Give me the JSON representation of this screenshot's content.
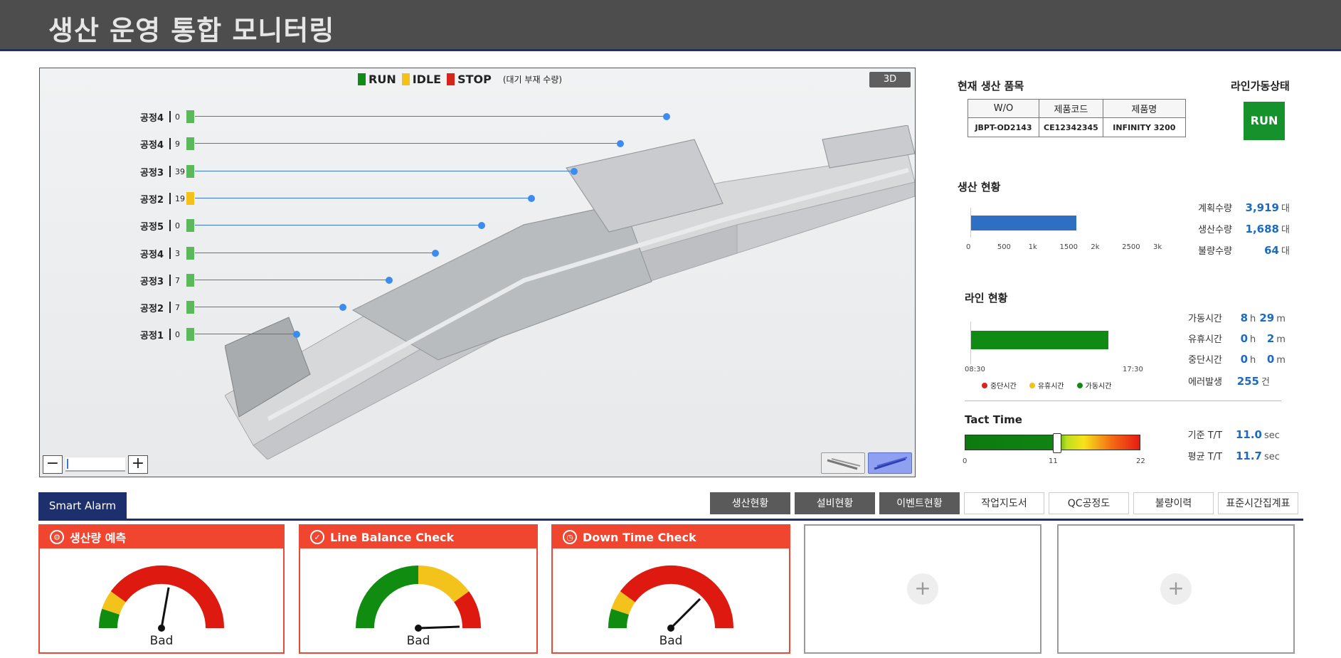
{
  "header": {
    "title": "생산 운영 통합 모니터링"
  },
  "viewer": {
    "legend": [
      {
        "label": "RUN",
        "color": "#128a18"
      },
      {
        "label": "IDLE",
        "color": "#f4c11a"
      },
      {
        "label": "STOP",
        "color": "#d8251b"
      }
    ],
    "legend_note": "(대기 부재 수량)",
    "btn_3d": "3D",
    "processes": [
      {
        "name": "공정4",
        "count": "0",
        "status": "run"
      },
      {
        "name": "공정4",
        "count": "9",
        "status": "run"
      },
      {
        "name": "공정3",
        "count": "39",
        "status": "run"
      },
      {
        "name": "공정2",
        "count": "19",
        "status": "idle"
      },
      {
        "name": "공정5",
        "count": "0",
        "status": "run"
      },
      {
        "name": "공정4",
        "count": "3",
        "status": "run"
      },
      {
        "name": "공정3",
        "count": "7",
        "status": "run"
      },
      {
        "name": "공정2",
        "count": "7",
        "status": "run"
      },
      {
        "name": "공정1",
        "count": "0",
        "status": "run"
      }
    ],
    "zoom_minus": "−",
    "zoom_plus": "+"
  },
  "product": {
    "title": "현재 생산 품목",
    "headers": [
      "W/O",
      "제품코드",
      "제품명"
    ],
    "row": [
      "JBPT-OD2143",
      "CE12342345",
      "INFINITY 3200"
    ]
  },
  "line_status": {
    "title": "라인가동상태",
    "value": "RUN"
  },
  "production": {
    "title": "생산 현황",
    "bar_value": 1688,
    "axis_max": 3000,
    "ticks": [
      "0",
      "500",
      "1k",
      "1500",
      "2k",
      "2500",
      "3k"
    ],
    "items": [
      {
        "label": "계획수량",
        "value": "3,919",
        "unit": "대"
      },
      {
        "label": "생산수량",
        "value": "1,688",
        "unit": "대"
      },
      {
        "label": "불량수량",
        "value": "64",
        "unit": "대"
      }
    ]
  },
  "line": {
    "title": "라인 현황",
    "run_fraction": 0.7,
    "start": "08:30",
    "end": "17:30",
    "legend": [
      {
        "label": "중단시간",
        "color": "#d8251b"
      },
      {
        "label": "유휴시간",
        "color": "#f4c11a"
      },
      {
        "label": "가동시간",
        "color": "#128a18"
      }
    ],
    "items": [
      {
        "label": "가동시간",
        "h": "8",
        "m": "29"
      },
      {
        "label": "유휴시간",
        "h": "0",
        "m": "2"
      },
      {
        "label": "중단시간",
        "h": "0",
        "m": "0"
      }
    ],
    "error_label": "에러발생",
    "error_value": "255",
    "error_unit": "건",
    "h_unit": "h",
    "m_unit": "m"
  },
  "tact": {
    "title": "Tact Time",
    "min": "0",
    "mid": "11",
    "max": "22",
    "items": [
      {
        "label": "기준 T/T",
        "value": "11.0",
        "unit": "sec"
      },
      {
        "label": "평균 T/T",
        "value": "11.7",
        "unit": "sec"
      }
    ]
  },
  "tabs": {
    "smart_alarm": "Smart Alarm",
    "items": [
      {
        "label": "생산현황",
        "dark": true
      },
      {
        "label": "설비현황",
        "dark": true
      },
      {
        "label": "이벤트현황",
        "dark": true
      },
      {
        "label": "작업지도서",
        "dark": false
      },
      {
        "label": "QC공정도",
        "dark": false
      },
      {
        "label": "불량이력",
        "dark": false
      },
      {
        "label": "표준시간집계표",
        "dark": false
      }
    ]
  },
  "cards": [
    {
      "title": "생산량 예측",
      "icon": "gear-icon",
      "status": "Bad",
      "needle_angle": 100,
      "segments": [
        0.1,
        0.2,
        1.0
      ],
      "colors": [
        "#108c10",
        "#f3c31b",
        "#de1a10"
      ]
    },
    {
      "title": "Line Balance Check",
      "icon": "check-icon",
      "status": "Bad",
      "needle_angle": 178,
      "segments": [
        0.5,
        0.8,
        1.0
      ],
      "colors": [
        "#108c10",
        "#f3c31b",
        "#de1a10"
      ]
    },
    {
      "title": "Down Time Check",
      "icon": "clock-icon",
      "status": "Bad",
      "needle_angle": 135,
      "segments": [
        0.1,
        0.2,
        1.0
      ],
      "colors": [
        "#108c10",
        "#f3c31b",
        "#de1a10"
      ]
    }
  ],
  "empty_cards": [
    "+",
    "+"
  ]
}
